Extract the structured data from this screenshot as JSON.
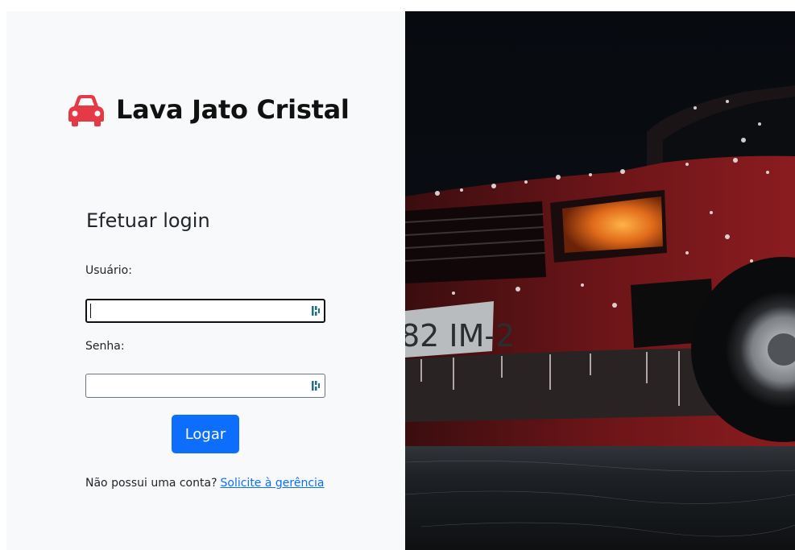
{
  "brand": {
    "title": "Lava Jato Cristal",
    "icon": "car-icon",
    "accent_color": "#e63946"
  },
  "login": {
    "heading": "Efetuar login",
    "user_label": "Usuário:",
    "user_value": "",
    "password_label": "Senha:",
    "password_value": "",
    "submit_label": "Logar",
    "signup_prompt": "Não possui uma conta?",
    "signup_link": "Solicite à gerência",
    "button_color": "#0d6efd",
    "link_color": "#0d6efd"
  },
  "hero": {
    "plate_text": "82 IM-2",
    "description": "red car covered in wash foam at night"
  }
}
